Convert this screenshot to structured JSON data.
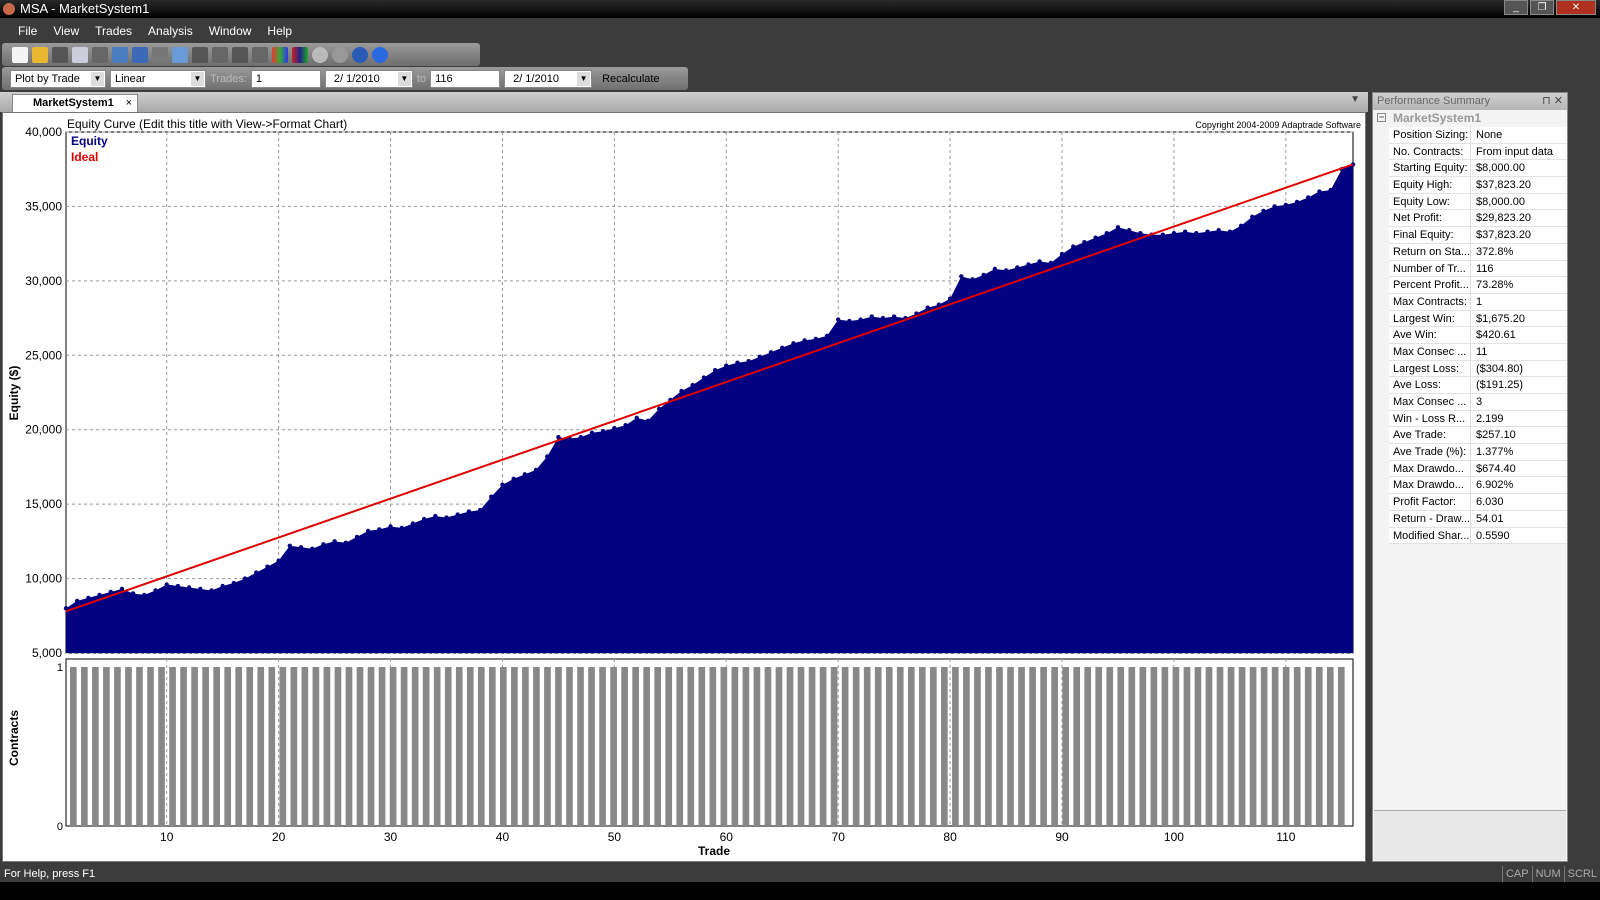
{
  "window": {
    "title": "MSA - MarketSystem1",
    "buttons": [
      "_",
      "❐",
      "✕"
    ]
  },
  "menu": [
    "File",
    "View",
    "Trades",
    "Analysis",
    "Window",
    "Help"
  ],
  "toolbar2": {
    "plot_mode": "Plot by Trade",
    "scale": "Linear",
    "trades_label": "Trades:",
    "trades_from": "1",
    "date_from": "2/ 1/2010",
    "to_label": "to",
    "trades_to": "116",
    "date_to": "2/ 1/2010",
    "recalc": "Recalculate"
  },
  "tab": {
    "label": "MarketSystem1",
    "close": "×"
  },
  "chart_data": [
    {
      "type": "area",
      "title": "Equity Curve (Edit this title with View->Format Chart)",
      "copyright": "Copyright 2004-2009 Adaptrade Software",
      "xlabel": "Trade",
      "ylabel": "Equity ($)",
      "ylim": [
        5000,
        40000
      ],
      "xlim": [
        1,
        116
      ],
      "yticks": [
        "5,000",
        "10,000",
        "15,000",
        "20,000",
        "25,000",
        "30,000",
        "35,000",
        "40,000"
      ],
      "ytick_values": [
        5000,
        10000,
        15000,
        20000,
        25000,
        30000,
        35000,
        40000
      ],
      "xticks": [
        10,
        20,
        30,
        40,
        50,
        60,
        70,
        80,
        90,
        100,
        110
      ],
      "grid": true,
      "legend_position": "top-left",
      "series": [
        {
          "name": "Equity",
          "color": "#000080",
          "values": [
            8000,
            8500,
            8700,
            8900,
            9100,
            9300,
            9000,
            8900,
            9200,
            9600,
            9500,
            9400,
            9300,
            9200,
            9500,
            9700,
            10000,
            10400,
            10800,
            11200,
            12200,
            12100,
            12000,
            12300,
            12500,
            12400,
            12800,
            13200,
            13300,
            13500,
            13400,
            13700,
            14000,
            14200,
            14100,
            14300,
            14500,
            14600,
            15500,
            16300,
            16700,
            17000,
            17300,
            18200,
            19500,
            19400,
            19500,
            19800,
            19900,
            20100,
            20300,
            20800,
            20600,
            21400,
            22000,
            22600,
            23000,
            23500,
            24000,
            24300,
            24500,
            24600,
            24900,
            25200,
            25500,
            25800,
            26000,
            26100,
            26300,
            27400,
            27300,
            27400,
            27600,
            27500,
            27600,
            27500,
            27800,
            28200,
            28400,
            28800,
            30300,
            30100,
            30400,
            30800,
            30700,
            30900,
            31100,
            31300,
            31200,
            31800,
            32300,
            32600,
            32900,
            33200,
            33600,
            33400,
            33200,
            33100,
            33100,
            33200,
            33300,
            33200,
            33300,
            33400,
            33300,
            33700,
            34300,
            34700,
            35000,
            35100,
            35300,
            35600,
            36000,
            36100,
            37500,
            37823.2
          ]
        },
        {
          "name": "Ideal",
          "color": "#e00000",
          "start": 7800,
          "end": 37823.2
        }
      ]
    },
    {
      "type": "bar",
      "ylabel": "Contracts",
      "ylim": [
        0,
        1
      ],
      "yticks": [
        "0",
        "1"
      ],
      "value_per_trade": 1,
      "count": 116,
      "color": "#888888"
    }
  ],
  "summary": {
    "header": "Performance Summary",
    "group": "MarketSystem1",
    "rows": [
      [
        "Position Sizing:",
        "None"
      ],
      [
        "No. Contracts:",
        "From input data"
      ],
      [
        "Starting Equity:",
        "$8,000.00"
      ],
      [
        "Equity High:",
        "$37,823.20"
      ],
      [
        "Equity Low:",
        "$8,000.00"
      ],
      [
        "Net Profit:",
        "$29,823.20"
      ],
      [
        "Final Equity:",
        "$37,823.20"
      ],
      [
        "Return on Sta...",
        "372.8%"
      ],
      [
        "Number of Tr...",
        "116"
      ],
      [
        "Percent Profit...",
        "73.28%"
      ],
      [
        "Max Contracts:",
        "1"
      ],
      [
        "Largest Win:",
        "$1,675.20"
      ],
      [
        "Ave Win:",
        "$420.61"
      ],
      [
        "Max Consec ...",
        "11"
      ],
      [
        "Largest Loss:",
        "($304.80)"
      ],
      [
        "Ave Loss:",
        "($191.25)"
      ],
      [
        "Max Consec ...",
        "3"
      ],
      [
        "Win - Loss R...",
        "2.199"
      ],
      [
        "Ave Trade:",
        "$257.10"
      ],
      [
        "Ave Trade (%):",
        "1.377%"
      ],
      [
        "Max Drawdo...",
        "$674.40"
      ],
      [
        "Max Drawdo...",
        "6.902%"
      ],
      [
        "Profit Factor:",
        "6.030"
      ],
      [
        "Return - Draw...",
        "54.01"
      ],
      [
        "Modified Shar...",
        "0.5590"
      ]
    ]
  },
  "status": {
    "text": "For Help, press F1",
    "indicators": [
      "CAP",
      "NUM",
      "SCRL"
    ]
  }
}
